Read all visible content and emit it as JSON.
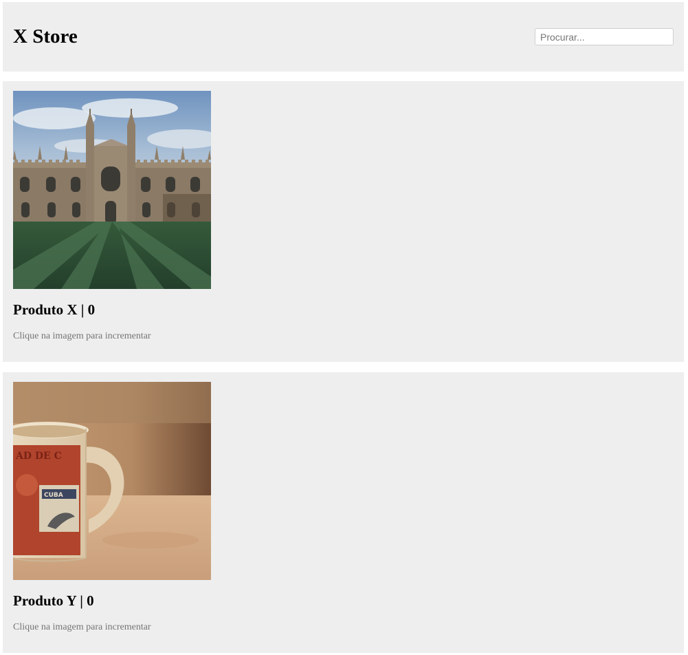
{
  "header": {
    "store_name": "X Store",
    "search_placeholder": "Procurar..."
  },
  "products": [
    {
      "name": "Produto X",
      "count": "0",
      "title": "Produto X | 0",
      "hint": "Clique na imagem para incrementar",
      "image": "college-building-on-lawn-photo"
    },
    {
      "name": "Produto Y",
      "count": "0",
      "title": "Produto Y | 0",
      "hint": "Clique na imagem para incrementar",
      "image": "vintage-stamp-mug-photo"
    }
  ]
}
